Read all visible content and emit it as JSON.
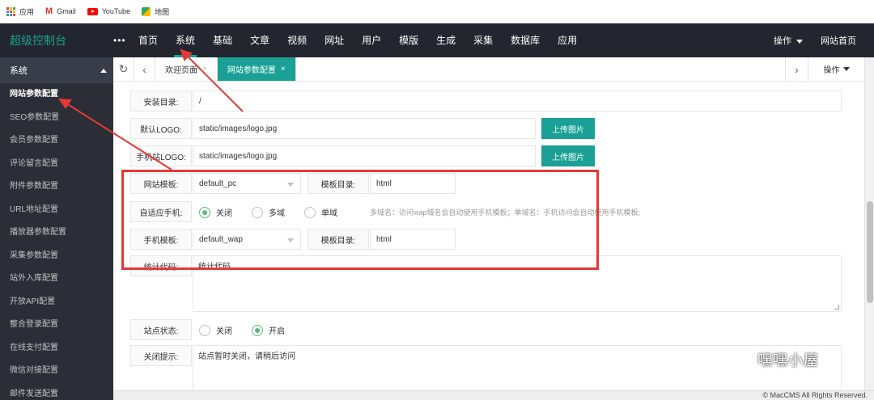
{
  "bookmarks": [
    {
      "label": "应用",
      "icon": "apps-grid-icon"
    },
    {
      "label": "Gmail",
      "icon": "gmail-icon"
    },
    {
      "label": "YouTube",
      "icon": "youtube-icon"
    },
    {
      "label": "地图",
      "icon": "maps-icon"
    }
  ],
  "header": {
    "brand": "超级控制台",
    "more": "•••",
    "nav": [
      "首页",
      "系统",
      "基础",
      "文章",
      "视频",
      "网址",
      "用户",
      "模版",
      "生成",
      "采集",
      "数据库",
      "应用"
    ],
    "active_nav": "系统",
    "operate": "操作",
    "site_home": "网站首页"
  },
  "sidebar": {
    "title": "系统",
    "items": [
      "网站参数配置",
      "SEO参数配置",
      "会员参数配置",
      "评论留言配置",
      "附件参数配置",
      "URL地址配置",
      "播放器参数配置",
      "采集参数配置",
      "站外入库配置",
      "开放API配置",
      "整合登录配置",
      "在线支付配置",
      "微信对接配置",
      "邮件发送配置"
    ],
    "active": "网站参数配置"
  },
  "tabs": {
    "items": [
      {
        "label": "欢迎页面",
        "close": "×"
      },
      {
        "label": "网站参数配置",
        "close": "×"
      }
    ],
    "active": "网站参数配置",
    "operate": "操作"
  },
  "form": {
    "install_dir": {
      "label": "安装目录:",
      "value": "/"
    },
    "default_logo": {
      "label": "默认LOGO:",
      "value": "static/images/logo.jpg",
      "button": "上传图片"
    },
    "mobile_logo": {
      "label": "手机站LOGO:",
      "value": "static/images/logo.jpg",
      "button": "上传图片"
    },
    "site_template": {
      "label": "网站模板:",
      "value": "default_pc",
      "dir_label": "模板目录:",
      "dir_value": "html"
    },
    "adaptive_mobile": {
      "label": "自适应手机:",
      "options": [
        "关闭",
        "多域",
        "单域"
      ],
      "selected": "关闭",
      "hint": "多域名：访问wap域名会自动使用手机模板；单域名：手机访问会自动使用手机模板;"
    },
    "mobile_template": {
      "label": "手机模板:",
      "value": "default_wap",
      "dir_label": "模板目录:",
      "dir_value": "html"
    },
    "stats_code": {
      "label": "统计代码:",
      "value": "统计代码"
    },
    "site_status": {
      "label": "站点状态:",
      "options": [
        "关闭",
        "开启"
      ],
      "selected": "开启"
    },
    "close_hint": {
      "label": "关闭提示:",
      "value": "站点暂时关闭，请稍后访问"
    }
  },
  "footer": {
    "copyright": "© MacCMS All Rights Reserved."
  },
  "watermark": {
    "text": "嘿嘿小屋"
  },
  "colors": {
    "accent": "#1aa094",
    "nav_bg": "#23262e",
    "sidebar_bg": "#2b2e36",
    "annotation": "#e53935",
    "radio_on": "#5fb878"
  }
}
